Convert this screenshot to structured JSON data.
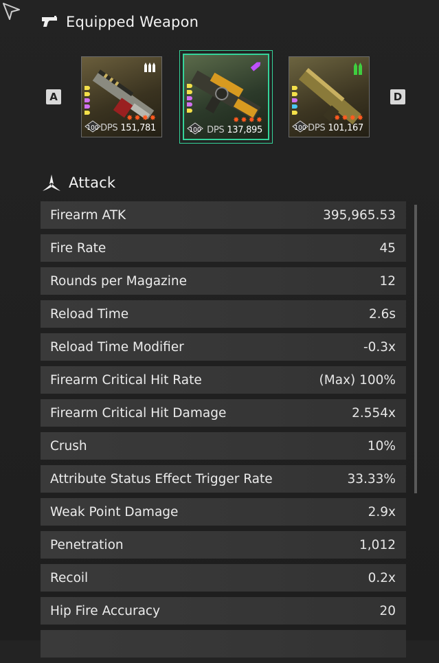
{
  "equipped": {
    "title": "Equipped Weapon",
    "key_left": "A",
    "key_right": "D",
    "weapons": [
      {
        "level": "100",
        "dps_label": "DPS",
        "dps": "151,781",
        "ammo_color": "#ffffff",
        "selected": false
      },
      {
        "level": "100",
        "dps_label": "DPS",
        "dps": "137,895",
        "ammo_color": "#c050ff",
        "selected": true
      },
      {
        "level": "100",
        "dps_label": "DPS",
        "dps": "101,167",
        "ammo_color": "#3fce3f",
        "selected": false
      }
    ]
  },
  "attack": {
    "title": "Attack",
    "stats": [
      {
        "label": "Firearm ATK",
        "value": "395,965.53"
      },
      {
        "label": "Fire Rate",
        "value": "45"
      },
      {
        "label": "Rounds per Magazine",
        "value": "12"
      },
      {
        "label": "Reload Time",
        "value": "2.6s"
      },
      {
        "label": "Reload Time Modifier",
        "value": "-0.3x"
      },
      {
        "label": "Firearm Critical Hit Rate",
        "value": "(Max) 100%"
      },
      {
        "label": "Firearm Critical Hit Damage",
        "value": "2.554x"
      },
      {
        "label": "Crush",
        "value": "10%"
      },
      {
        "label": "Attribute Status Effect Trigger Rate",
        "value": "33.33%"
      },
      {
        "label": "Weak Point Damage",
        "value": "2.9x"
      },
      {
        "label": "Penetration",
        "value": "1,012"
      },
      {
        "label": "Recoil",
        "value": "0.2x"
      },
      {
        "label": "Hip Fire Accuracy",
        "value": "20"
      }
    ]
  },
  "colors": {
    "accent": "#35d49a",
    "star": "#ff5a1f"
  }
}
